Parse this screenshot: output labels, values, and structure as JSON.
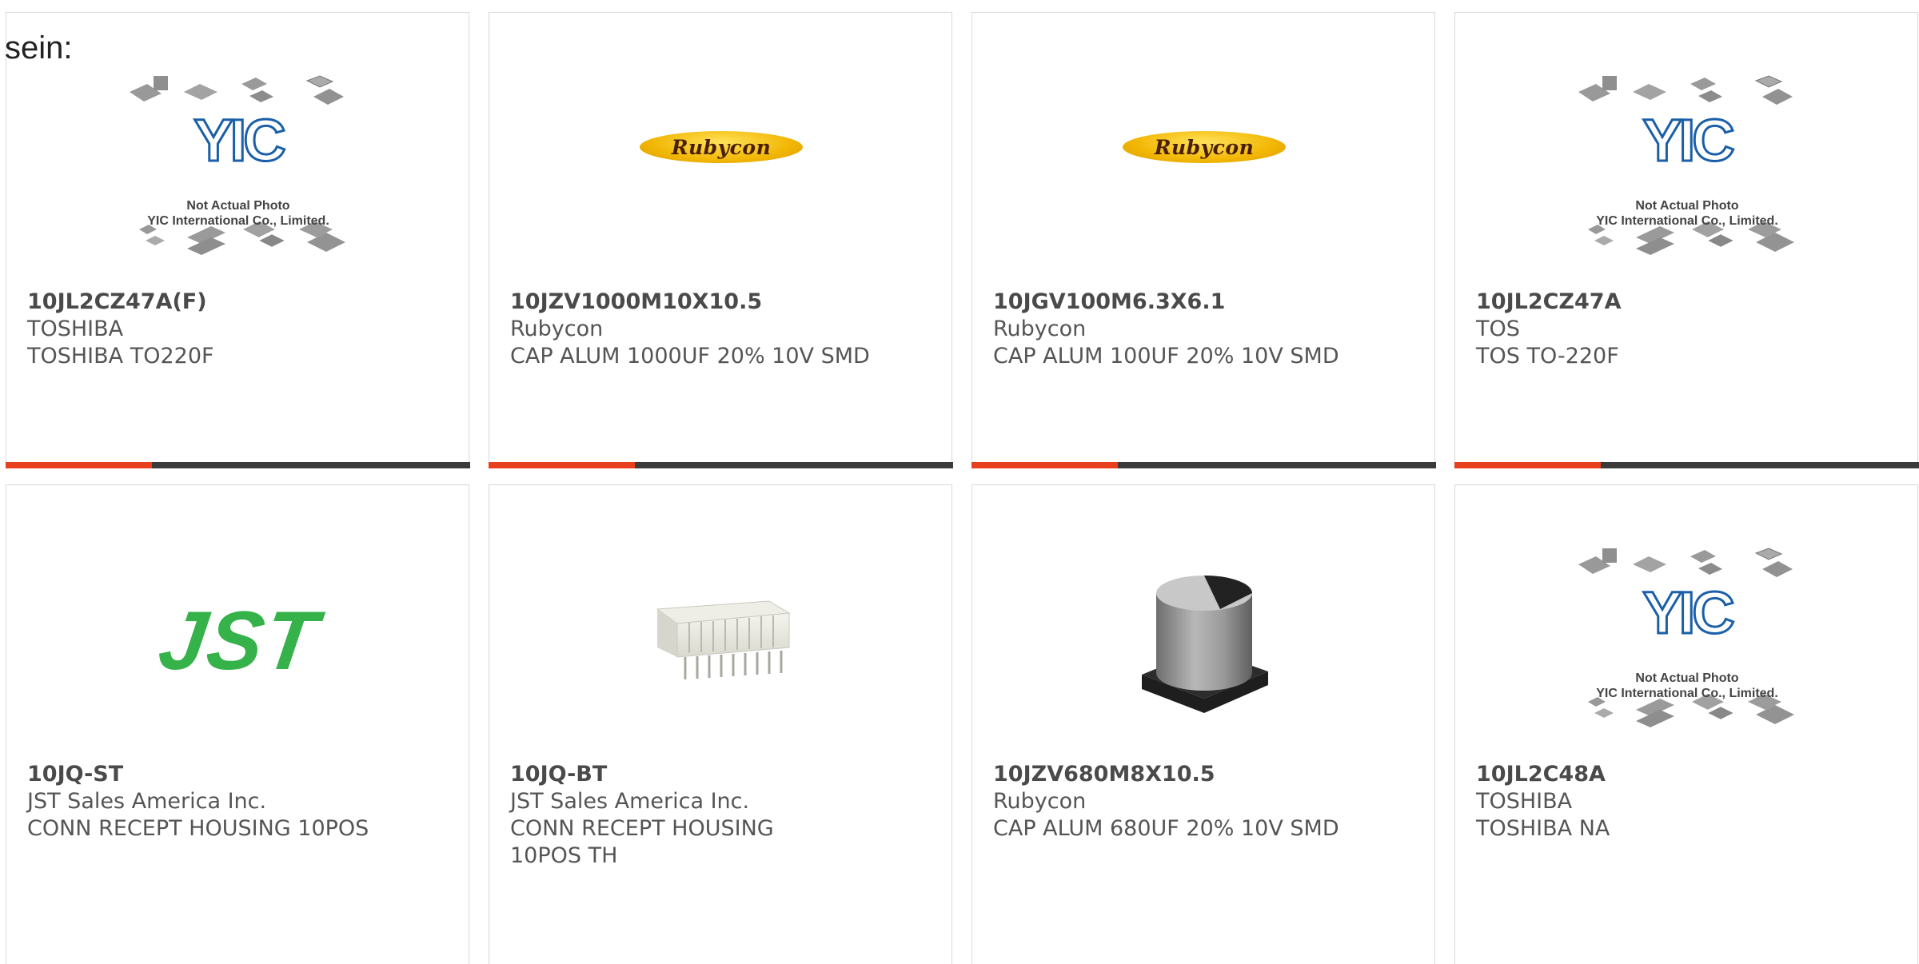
{
  "intro_text": "sein:",
  "colors": {
    "accent": "#e8401c",
    "bar": "#3b3b3b",
    "jst_green": "#36b24a",
    "rubycon_yellow": "#f2b705"
  },
  "products": [
    {
      "part": "10JL2CZ47A(F)",
      "maker": "TOSHIBA",
      "desc": "TOSHIBA TO220F",
      "image": "yic-placeholder"
    },
    {
      "part": "10JZV1000M10X10.5",
      "maker": "Rubycon",
      "desc": "CAP ALUM 1000UF 20% 10V SMD",
      "image": "rubycon-logo"
    },
    {
      "part": "10JGV100M6.3X6.1",
      "maker": "Rubycon",
      "desc": "CAP ALUM 100UF 20% 10V SMD",
      "image": "rubycon-logo"
    },
    {
      "part": "10JL2CZ47A",
      "maker": "TOS",
      "desc": "TOS TO-220F",
      "image": "yic-placeholder"
    },
    {
      "part": "10JQ-ST",
      "maker": "JST Sales America Inc.",
      "desc": "CONN RECEPT HOUSING 10POS",
      "image": "jst-logo"
    },
    {
      "part": "10JQ-BT",
      "maker": "JST Sales America Inc.",
      "desc": "CONN RECEPT HOUSING 10POS TH",
      "image": "connector-photo"
    },
    {
      "part": "10JZV680M8X10.5",
      "maker": "Rubycon",
      "desc": "CAP ALUM 680UF 20% 10V SMD",
      "image": "capacitor-photo"
    },
    {
      "part": "10JL2C48A",
      "maker": "TOSHIBA",
      "desc": "TOSHIBA NA",
      "image": "yic-placeholder"
    }
  ],
  "logos": {
    "rubycon": "Rubycon",
    "jst": "JST",
    "yic_line1": "Not Actual Photo",
    "yic_line2": "YIC International Co., Limited."
  }
}
